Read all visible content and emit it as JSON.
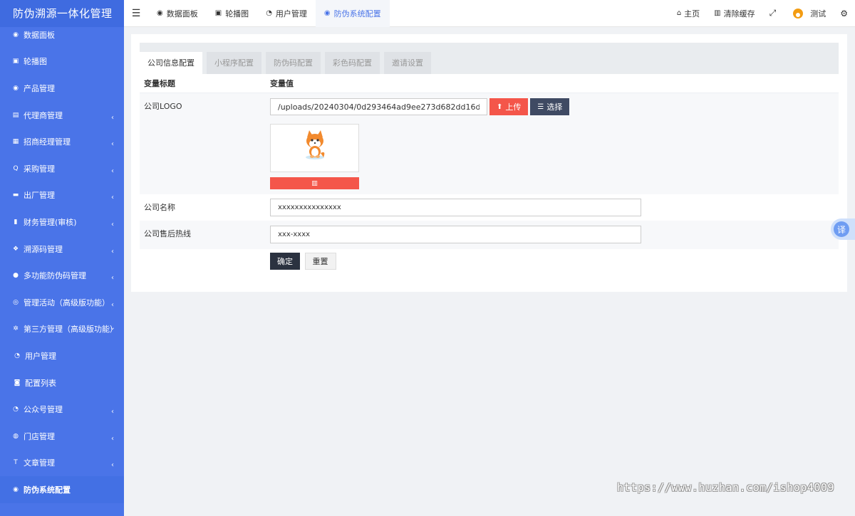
{
  "app": {
    "title": "防伪溯源一体化管理"
  },
  "sidebar": {
    "items": [
      {
        "label": "数据面板",
        "icon": "dashboard-icon",
        "glyph": "◉",
        "has_children": false
      },
      {
        "label": "轮播图",
        "icon": "image-icon",
        "glyph": "▣",
        "has_children": false
      },
      {
        "label": "产品管理",
        "icon": "product-icon",
        "glyph": "◉",
        "has_children": false
      },
      {
        "label": "代理商管理",
        "icon": "id-card-icon",
        "glyph": "▤",
        "has_children": true
      },
      {
        "label": "招商经理管理",
        "icon": "contact-icon",
        "glyph": "▦",
        "has_children": true
      },
      {
        "label": "采购管理",
        "icon": "search-icon",
        "glyph": "Q",
        "has_children": true
      },
      {
        "label": "出厂管理",
        "icon": "truck-icon",
        "glyph": "▬",
        "has_children": true
      },
      {
        "label": "财务管理(审核)",
        "icon": "finance-icon",
        "glyph": "▮",
        "has_children": true
      },
      {
        "label": "溯源码管理",
        "icon": "cubes-icon",
        "glyph": "❖",
        "has_children": true
      },
      {
        "label": "多功能防伪码管理",
        "icon": "info-icon",
        "glyph": "●",
        "has_children": true
      },
      {
        "label": "管理活动（高级版功能）",
        "icon": "target-icon",
        "glyph": "◎",
        "has_children": true
      },
      {
        "label": "第三方管理（高级版功能）",
        "icon": "share-icon",
        "glyph": "✲",
        "has_children": true,
        "expanded": true
      },
      {
        "label": "用户管理",
        "icon": "wechat-icon",
        "glyph": "◔",
        "has_children": false,
        "indent": true
      },
      {
        "label": "配置列表",
        "icon": "config-icon",
        "glyph": "◙",
        "has_children": false,
        "indent": true
      },
      {
        "label": "公众号管理",
        "icon": "wechat-icon",
        "glyph": "◔",
        "has_children": true
      },
      {
        "label": "门店管理",
        "icon": "store-icon",
        "glyph": "◍",
        "has_children": true
      },
      {
        "label": "文章管理",
        "icon": "text-icon",
        "glyph": "T",
        "has_children": true
      },
      {
        "label": "防伪系统配置",
        "icon": "gear-circle-icon",
        "glyph": "◉",
        "has_children": false,
        "active": true
      }
    ]
  },
  "topbar": {
    "tabs": [
      {
        "label": "数据面板",
        "glyph": "◉"
      },
      {
        "label": "轮播图",
        "glyph": "▣"
      },
      {
        "label": "用户管理",
        "glyph": "◔"
      },
      {
        "label": "防伪系统配置",
        "glyph": "◉"
      }
    ],
    "home": "主页",
    "clear_cache": "清除缓存",
    "user": "测试"
  },
  "config": {
    "tabs": [
      "公司信息配置",
      "小程序配置",
      "防伪码配置",
      "彩色码配置",
      "邀请设置"
    ],
    "active_tab": 0,
    "col_title": "变量标题",
    "col_value": "变量值",
    "logo_label": "公司LOGO",
    "logo_path": "/uploads/20240304/0d293464ad9ee273d682dd16dd1e84b7.jpg",
    "upload_label": "上传",
    "select_label": "选择",
    "name_label": "公司名称",
    "name_value": "xxxxxxxxxxxxxxx",
    "hotline_label": "公司售后热线",
    "hotline_value": "xxx-xxxx",
    "confirm_label": "确定",
    "reset_label": "重置"
  },
  "translate_label": "译",
  "watermark": "https://www.huzhan.com/ishop4009",
  "colors": {
    "sidebar": "#4a74e8",
    "danger": "#f4564a",
    "dark": "#3f4a63"
  }
}
